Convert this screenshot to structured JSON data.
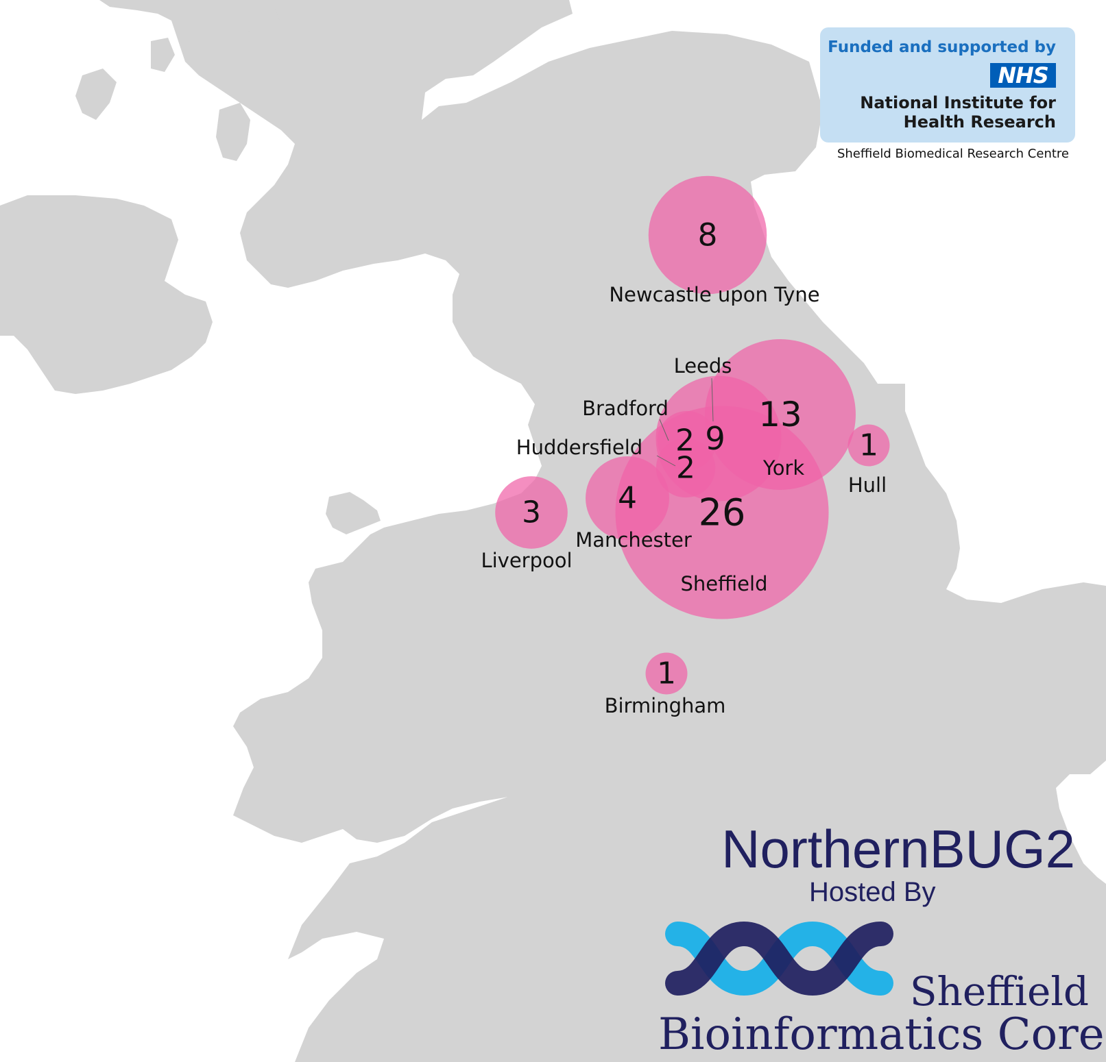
{
  "map": {
    "land_color": "#d3d3d3",
    "bubble_color": "#f062a8",
    "markers": [
      {
        "city": "Newcastle upon Tyne",
        "count": 8
      },
      {
        "city": "Leeds",
        "count": 9
      },
      {
        "city": "York",
        "count": 13
      },
      {
        "city": "Bradford",
        "count": 2
      },
      {
        "city": "Huddersfield",
        "count": 2
      },
      {
        "city": "Hull",
        "count": 1
      },
      {
        "city": "Manchester",
        "count": 4
      },
      {
        "city": "Liverpool",
        "count": 3
      },
      {
        "city": "Sheffield",
        "count": 26
      },
      {
        "city": "Birmingham",
        "count": 1
      }
    ]
  },
  "funding": {
    "funded_text": "Funded and supported by",
    "nhs_logo": "NHS",
    "institute_line1": "National Institute for",
    "institute_line2": "Health Research",
    "centre": "Sheffield Biomedical Research Centre",
    "box_color": "#c5dff3",
    "accent_color": "#005eb8"
  },
  "event": {
    "title": "NorthernBUG2",
    "hosted_by": "Hosted By",
    "host_line1": "Sheffield",
    "host_line2": "Bioinformatics Core",
    "navy_color": "#20205f",
    "cyan_color": "#1ab0e8"
  }
}
